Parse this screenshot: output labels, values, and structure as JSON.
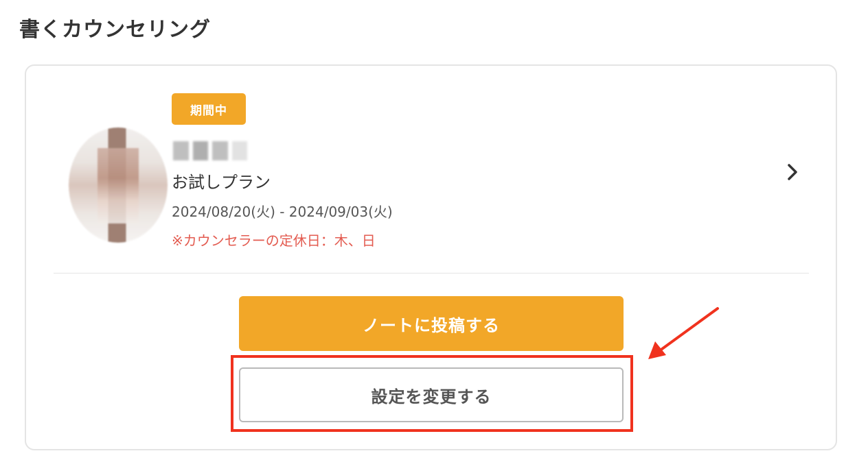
{
  "section": {
    "title": "書くカウンセリング"
  },
  "card": {
    "status_badge": "期間中",
    "plan_name": "お試しプラン",
    "period": "2024/08/20(火) - 2024/09/03(火)",
    "holiday_note": "※カウンセラーの定休日：木、日",
    "chevron_icon": "chevron-right-icon"
  },
  "actions": {
    "post_label": "ノートに投稿する",
    "settings_label": "設定を変更する"
  },
  "colors": {
    "accent": "#f2a728",
    "note_red": "#e35b50",
    "highlight_red": "#f0321e"
  }
}
